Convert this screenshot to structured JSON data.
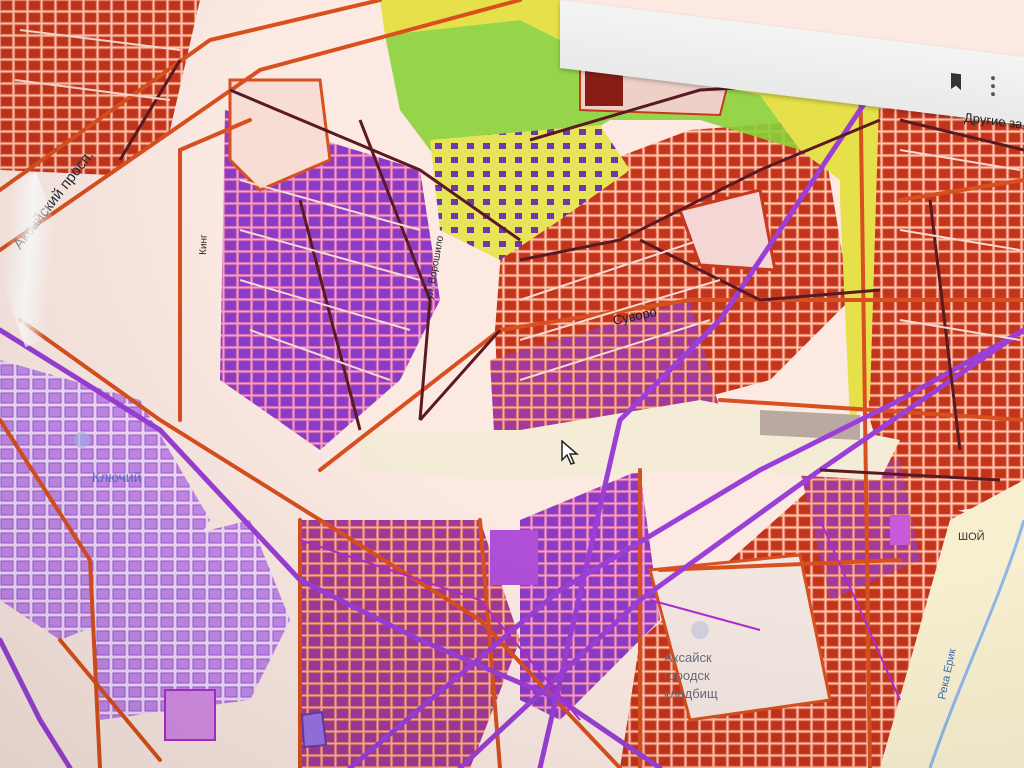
{
  "browser": {
    "other_bookmarks": "Другие за",
    "bookmark_icon": "bookmark-icon",
    "menu_icon": "kebab-menu-icon"
  },
  "map": {
    "labels": {
      "avenue": "Аксайский просп.",
      "street_1": "Кинг",
      "street_2": "ул. Ворошило",
      "district": "Ключий",
      "neighborhood": "Суворо",
      "cemetery_1": "Аксайск",
      "cemetery_2": "городск",
      "cemetery_3": "кладбищ",
      "river": "Река Ерик",
      "place": "ШОЙ"
    },
    "colors": {
      "parcel_red": "#d23a1f",
      "parcel_fill": "#c2341c",
      "purple": "#9b3fd6",
      "magenta": "#b02bd0",
      "yellow": "#e6e04a",
      "green": "#8bd23a",
      "background": "#fbe9e2"
    },
    "cursor_icon": "mouse-pointer-icon"
  }
}
